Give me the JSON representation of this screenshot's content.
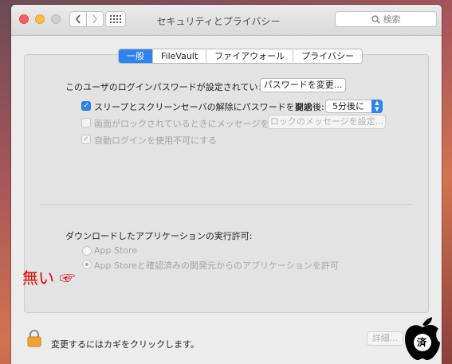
{
  "window": {
    "title": "セキュリティとプライバシー",
    "search_placeholder": "検索"
  },
  "tabs": [
    {
      "label": "一般",
      "active": true
    },
    {
      "label": "FileVault",
      "active": false
    },
    {
      "label": "ファイアウォール",
      "active": false
    },
    {
      "label": "プライバシー",
      "active": false
    }
  ],
  "general": {
    "password_text": "このユーザのログインパスワードが設定されています",
    "change_password_button": "パスワードを変更...",
    "require_password_label": "スリープとスクリーンセーバの解除にパスワードを要求",
    "require_password_checked": true,
    "start_after_label": "開始後:",
    "start_after_value": "5分後に",
    "show_message_label": "画面がロックされているときにメッセージを表示",
    "show_message_checked": false,
    "set_lock_message_button": "ロックのメッセージを設定...",
    "disable_auto_login_label": "自動ログインを使用不可にする",
    "disable_auto_login_checked": true
  },
  "downloads": {
    "heading": "ダウンロードしたアプリケーションの実行許可:",
    "option_app_store": "App Store",
    "option_identified": "App Storeと確認済みの開発元からのアプリケーションを許可",
    "selected": "option_identified"
  },
  "annotation": {
    "text": "無い",
    "pointer": "☞",
    "color": "#e00000"
  },
  "footer": {
    "lock_text": "変更するにはカギをクリックします。",
    "advanced_button": "詳細..."
  },
  "logo": {
    "badge_text": "済"
  },
  "colors": {
    "accent": "#2f83ee",
    "close": "#fc605c",
    "minimize": "#fdbc40"
  }
}
